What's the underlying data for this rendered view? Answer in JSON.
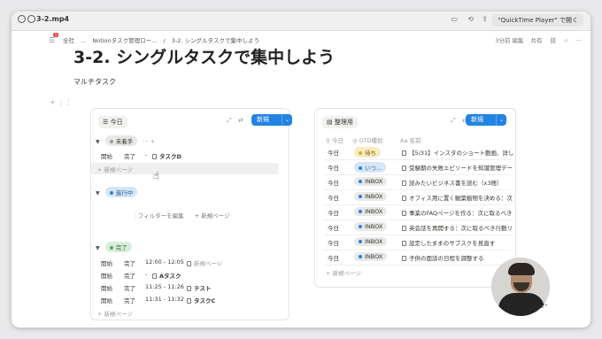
{
  "qt": {
    "title": "3-2.mp4",
    "open_label": "\"QuickTime Player\" で開く"
  },
  "notion_bar": {
    "crumbs": [
      "全社",
      "...",
      "Notionタスク管理ロー...",
      "/",
      "3-2. シングルタスクで集中しよう"
    ],
    "edited": "3分前 編集",
    "share": "共有"
  },
  "page": {
    "title": "3-2. シングルタスクで集中しよう",
    "subtext": "マルチタスク"
  },
  "left_panel": {
    "view_label": "今日",
    "new_label": "新規",
    "groups": {
      "todo": {
        "label": "未着手",
        "extra": "···  +"
      },
      "doing": {
        "label": "進行中"
      },
      "done": {
        "label": "完了"
      }
    },
    "todo_rows": [
      {
        "start": "開始",
        "end": "完了",
        "time": "-",
        "title": "タスクD"
      }
    ],
    "new_page": "新規ページ",
    "doing_actions": {
      "filter": "フィルターを編集",
      "new_page": "新規ページ"
    },
    "done_rows": [
      {
        "start": "開始",
        "end": "完了",
        "time": "12:00 - 12:05",
        "title": "新規ページ",
        "muted": true
      },
      {
        "start": "開始",
        "end": "完了",
        "time": "-",
        "title": "Aタスク",
        "muted": false
      },
      {
        "start": "開始",
        "end": "完了",
        "time": "11:25 - 11:26",
        "title": "テスト",
        "muted": false
      },
      {
        "start": "開始",
        "end": "完了",
        "time": "11:31 - 11:32",
        "title": "タスクC",
        "muted": false
      }
    ],
    "done_new_page": "新規ページ"
  },
  "right_panel": {
    "view_label": "整理用",
    "new_label": "新規",
    "headers": {
      "today": "今日",
      "gtd": "GTD種別",
      "name": "名前"
    },
    "rows": [
      {
        "today": "今日",
        "gtd": "待ち",
        "gtd_style": "yellow",
        "name": "【5/31】インスタのショート動画、詳し"
      },
      {
        "today": "今日",
        "gtd": "いつ...",
        "gtd_style": "blue",
        "name": "受験期の失敗エピソードを知識管理デー"
      },
      {
        "today": "今日",
        "gtd": "INBOX",
        "gtd_style": "gray",
        "name": "読みたいビジネス書を読む（x3冊）"
      },
      {
        "today": "今日",
        "gtd": "INBOX",
        "gtd_style": "gray",
        "name": "オフィス用に置く観葉植物を決める：次"
      },
      {
        "today": "今日",
        "gtd": "INBOX",
        "gtd_style": "gray",
        "name": "事業のFAQページを作る：次に取るべき"
      },
      {
        "today": "今日",
        "gtd": "INBOX",
        "gtd_style": "gray",
        "name": "英会話を再開する：次に取るべき行動リ"
      },
      {
        "today": "今日",
        "gtd": "INBOX",
        "gtd_style": "gray",
        "name": "設定したままのサブスクを見直す"
      },
      {
        "today": "今日",
        "gtd": "INBOX",
        "gtd_style": "gray",
        "name": "子供の面談の日程を調整する"
      }
    ],
    "new_page": "新規ページ"
  },
  "colors": {
    "accent": "#2383e2",
    "todo_dot": "#9b9a97",
    "doing_dot": "#2383e2",
    "done_dot": "#4dab6a",
    "waiting_dot": "#e6a23c"
  }
}
